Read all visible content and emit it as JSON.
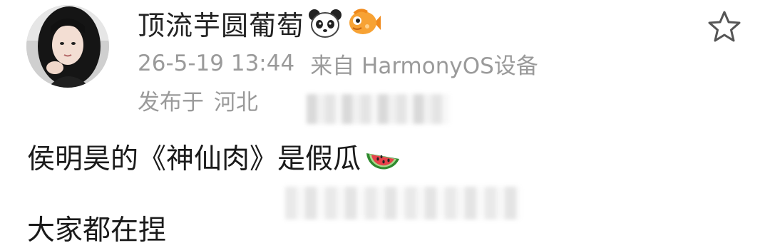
{
  "post": {
    "author": "顶流芋圆葡萄",
    "badges": [
      "panda-icon",
      "fish-icon"
    ],
    "date": "26-5-19 13:44",
    "source": "来自 HarmonyOS设备",
    "location_label": "发布于",
    "location": "河北",
    "content": "侯明昊的《神仙肉》是假瓜",
    "content_emoji": "watermelon-icon",
    "next_line": "大家都在捏"
  },
  "colors": {
    "meta_text": "#9a9a9a",
    "name_text": "#222222",
    "body_text": "#1a1a1a"
  }
}
